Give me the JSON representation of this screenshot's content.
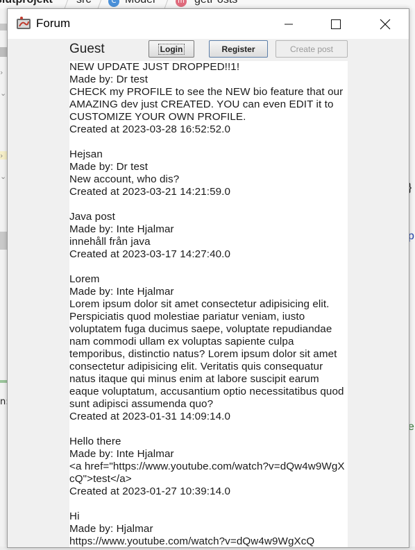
{
  "ide": {
    "breadcrumbs": [
      "slutprojekt",
      "src",
      "Model",
      "getPosts"
    ],
    "right_fragments": [
      "}",
      "p",
      "e"
    ],
    "left_fragments": [
      "n:"
    ]
  },
  "window": {
    "title": "Forum",
    "controls": [
      "minimize",
      "maximize",
      "close"
    ]
  },
  "toolbar": {
    "user_label": "Guest",
    "login_label": "Login",
    "register_label": "Register",
    "create_post_label": "Create post"
  },
  "posts": [
    {
      "title": "NEW UPDATE JUST DROPPED!!1!",
      "author": "Made by: Dr test",
      "body": "CHECK my PROFILE to see the NEW bio feature that our AMAZING dev just CREATED. YOU can even EDIT it to CUSTOMIZE YOUR OWN PROFILE.",
      "created": "Created at 2023-03-28 16:52:52.0"
    },
    {
      "title": "Hejsan",
      "author": "Made by: Dr test",
      "body": "New account, who dis?",
      "created": "Created at 2023-03-21 14:21:59.0"
    },
    {
      "title": "Java post",
      "author": "Made by: Inte Hjalmar",
      "body": "innehåll från java",
      "created": "Created at 2023-03-17 14:27:40.0"
    },
    {
      "title": "Lorem",
      "author": "Made by: Inte Hjalmar",
      "body": "Lorem ipsum dolor sit amet consectetur adipisicing elit. Perspiciatis quod molestiae pariatur veniam, iusto voluptatem fuga ducimus saepe, voluptate repudiandae nam commodi ullam ex voluptas sapiente culpa temporibus, distinctio natus? Lorem ipsum dolor sit amet consectetur adipisicing elit. Veritatis quis consequatur natus itaque qui minus enim at labore suscipit earum eaque voluptatum, accusantium optio necessitatibus quod sunt adipisci assumenda quo?",
      "created": "Created at 2023-01-31 14:09:14.0"
    },
    {
      "title": "Hello there",
      "author": "Made by: Inte Hjalmar",
      "body": "<a href=\"https://www.youtube.com/watch?v=dQw4w9WgXcQ\">test</a>",
      "created": "Created at 2023-01-27 10:39:14.0"
    },
    {
      "title": "Hi",
      "author": "Made by: Hjalmar",
      "body": "https://www.youtube.com/watch?v=dQw4w9WgXcQ",
      "created": ""
    }
  ]
}
